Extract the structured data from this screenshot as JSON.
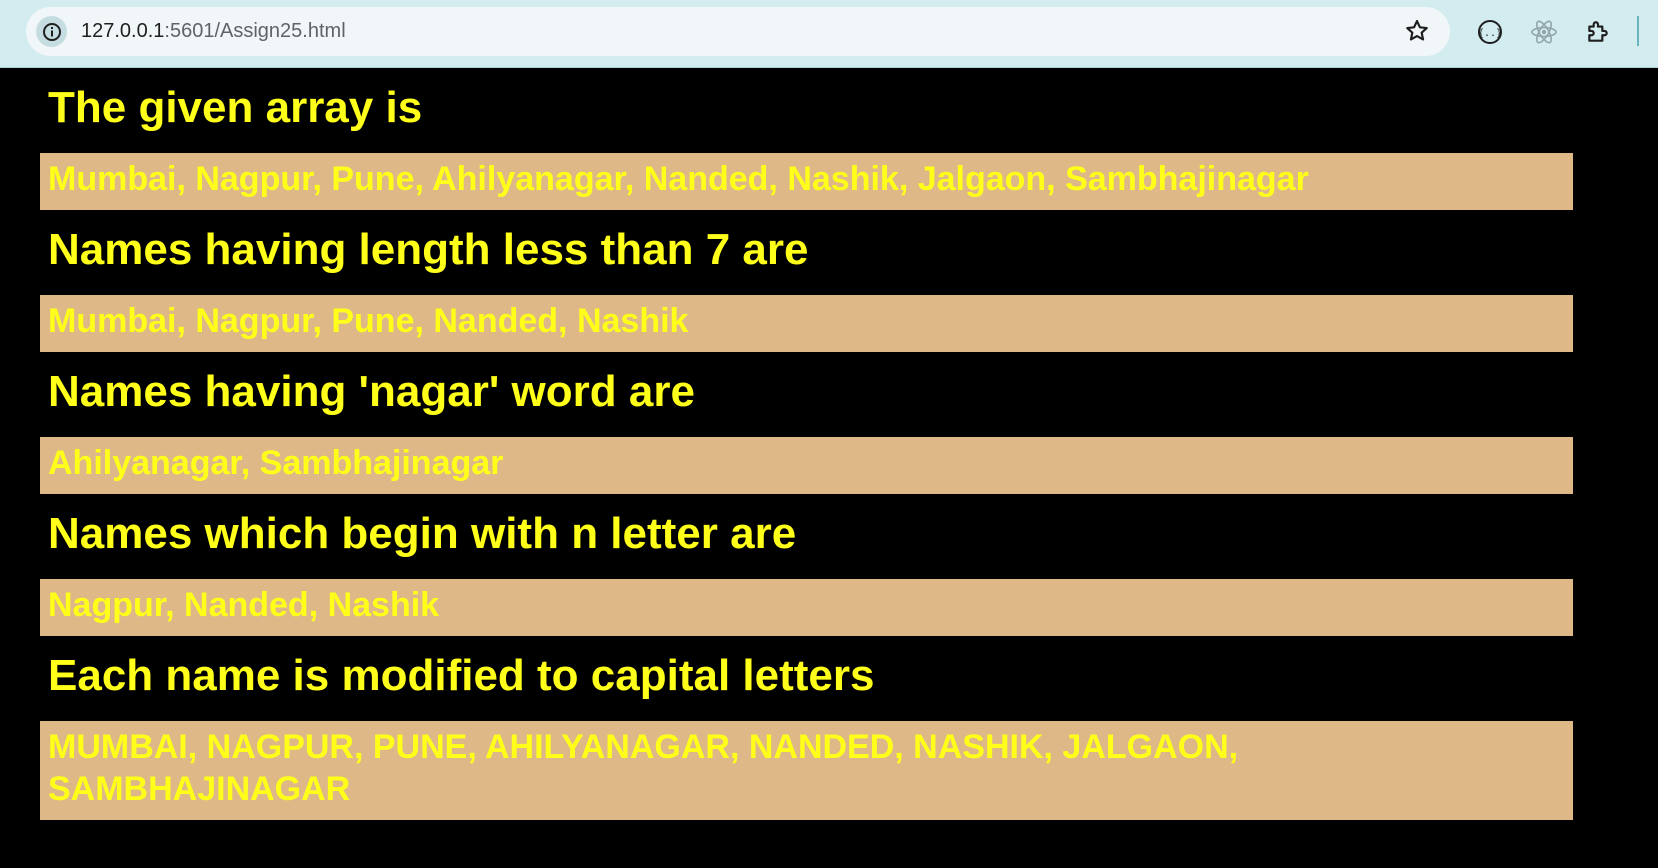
{
  "browser": {
    "url_host": "127.0.0.1",
    "url_path": ":5601/Assign25.html"
  },
  "sections": [
    {
      "heading": "The given array is",
      "content": "Mumbai, Nagpur, Pune, Ahilyanagar, Nanded, Nashik, Jalgaon, Sambhajinagar"
    },
    {
      "heading": "Names having length less than 7 are",
      "content": "Mumbai, Nagpur, Pune, Nanded, Nashik"
    },
    {
      "heading": "Names having 'nagar' word are",
      "content": "Ahilyanagar, Sambhajinagar"
    },
    {
      "heading": "Names which begin with n letter are",
      "content": "Nagpur, Nanded, Nashik"
    },
    {
      "heading": "Each name is modified to capital letters",
      "content": "MUMBAI, NAGPUR, PUNE, AHILYANAGAR, NANDED, NASHIK, JALGAON, SAMBHAJINAGAR"
    }
  ],
  "colors": {
    "text": "#ffff1a",
    "box": "#deb887",
    "background": "#000000"
  }
}
